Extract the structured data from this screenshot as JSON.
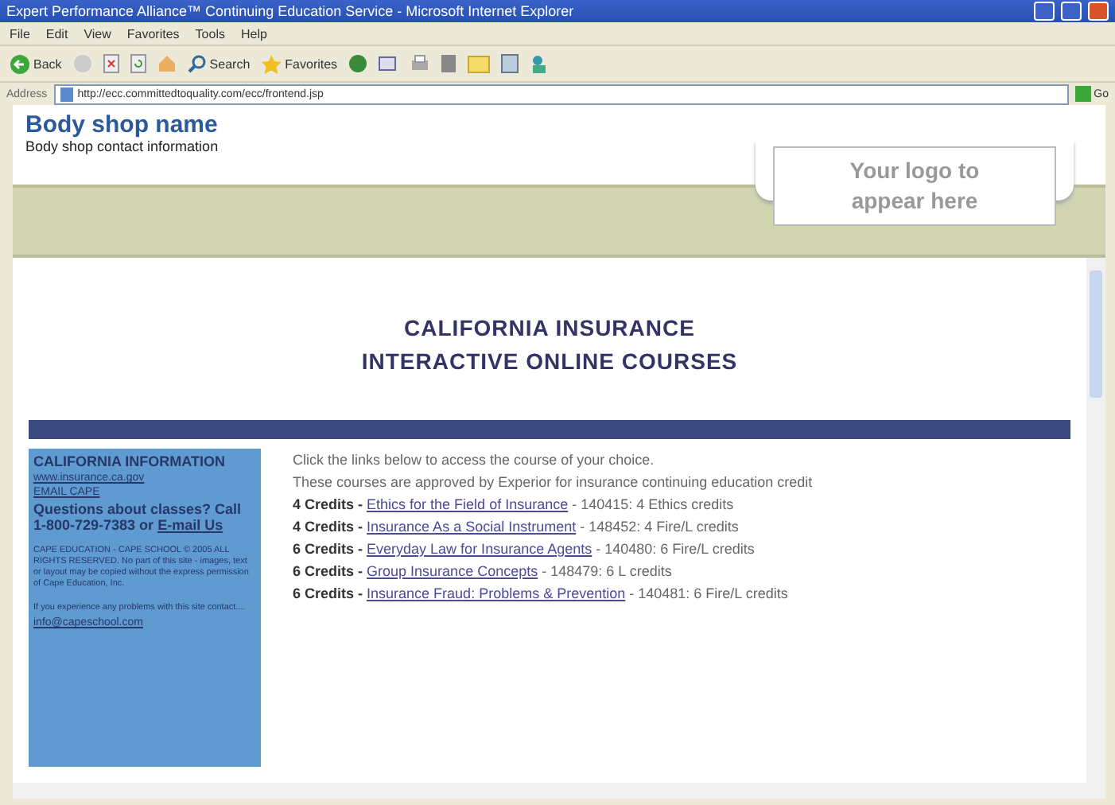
{
  "window": {
    "title": "Expert Performance Alliance™ Continuing Education Service - Microsoft Internet Explorer"
  },
  "menu": [
    "File",
    "Edit",
    "View",
    "Favorites",
    "Tools",
    "Help"
  ],
  "toolbar": [
    {
      "kind": "back",
      "label": "Back"
    },
    {
      "kind": "forward"
    },
    {
      "kind": "stop"
    },
    {
      "kind": "refresh"
    },
    {
      "kind": "home"
    },
    {
      "kind": "search",
      "label": "Search"
    },
    {
      "kind": "favorites",
      "label": "Favorites"
    },
    {
      "kind": "media"
    },
    {
      "kind": "mail"
    },
    {
      "kind": "print"
    },
    {
      "kind": "edit"
    },
    {
      "kind": "folder"
    },
    {
      "kind": "page"
    },
    {
      "kind": "messenger"
    }
  ],
  "address": {
    "label": "Address",
    "value": "http://ecc.committedtoquality.com/ecc/frontend.jsp",
    "go": "Go"
  },
  "header": {
    "shop_name": "Body shop name",
    "shop_info": "Body shop contact information",
    "logo": "Your logo to appear here"
  },
  "headline": [
    "CALIFORNIA INSURANCE",
    "INTERACTIVE ONLINE COURSES"
  ],
  "sidebar": {
    "title": "CALIFORNIA INFORMATION",
    "links": [
      "www.insurance.ca.gov",
      "EMAIL CAPE"
    ],
    "question": "Questions about classes? Call 1-800-729-7383 or ",
    "question_link": "E-mail Us",
    "legal": "CAPE EDUCATION - CAPE SCHOOL © 2005 ALL RIGHTS RESERVED. No part of this site - images, text or layout may be copied without the express permission of Cape Education, Inc.",
    "problems": "If you experience any problems with this site contact....",
    "email": "info@capeschool.com"
  },
  "intro": [
    "Click the links below to access the course of your choice.",
    "These courses are approved by Experior for insurance continuing education credit"
  ],
  "courses": [
    {
      "credits": "4 Credits -",
      "title": "Ethics for the Field of Insurance",
      "detail": "- 140415: 4 Ethics credits"
    },
    {
      "credits": "4 Credits -",
      "title": "Insurance As a Social Instrument",
      "detail": "- 148452: 4 Fire/L credits"
    },
    {
      "credits": "6 Credits -",
      "title": "Everyday Law for Insurance Agents",
      "detail": "- 140480: 6 Fire/L credits"
    },
    {
      "credits": "6 Credits -",
      "title": "Group Insurance Concepts",
      "detail": "- 148479: 6 L credits"
    },
    {
      "credits": "6 Credits -",
      "title": "Insurance Fraud: Problems & Prevention",
      "detail": "- 140481: 6 Fire/L credits"
    }
  ]
}
